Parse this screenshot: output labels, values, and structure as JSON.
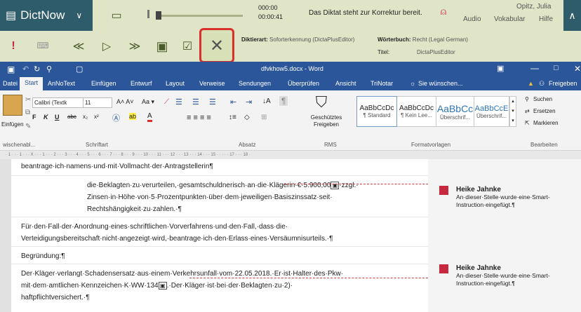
{
  "dictnow": {
    "app_name": "DictNow",
    "time_current": "000:00",
    "time_total": "00:00:41",
    "status": "Das Diktat steht zur Korrektur bereit.",
    "audio": "Audio",
    "vocabulary": "Vokabular",
    "help": "Hilfe",
    "user": "Opitz, Julia",
    "dictation_type_label": "Diktierart:",
    "dictation_type_value": "Soforterkennung (DictaPlusEditor)",
    "dictionary_label": "Wörterbuch:",
    "dictionary_value": "Recht (Legal German)",
    "title_label": "Titel:",
    "title_value": "DictaPlusEditor"
  },
  "word": {
    "title": "dfvkhow5.docx - Word",
    "tabs": [
      "Datei",
      "Start",
      "AnNoText",
      "Einfügen",
      "Entwurf",
      "Layout",
      "Verweise",
      "Sendungen",
      "Überprüfen",
      "Ansicht",
      "TriNotar"
    ],
    "tell_me": "Sie wünschen...",
    "share": "Freigeben",
    "ribbon": {
      "paste": "Einfügen",
      "font_name": "Calibri (Textk",
      "font_size": "11",
      "shared_label": "Geschütztes Freigeben",
      "styles": [
        {
          "sample": "AaBbCcDc",
          "name": "¶ Standard"
        },
        {
          "sample": "AaBbCcDc",
          "name": "¶ Kein Lee..."
        },
        {
          "sample": "AaBbCc",
          "name": "Überschrif..."
        },
        {
          "sample": "AaBbCcE",
          "name": "Überschrif..."
        }
      ],
      "search": "Suchen",
      "replace": "Ersetzen",
      "mark": "Markieren",
      "groups": [
        "wischenabl...",
        "Schriftart",
        "Absatz",
        "RMS",
        "Formatvorlagen",
        "Bearbeiten"
      ]
    },
    "ruler": "· 1 · · · 1 · · · X · · · 1 · · · 2 · · · 3 · · · 4 · · · 5 · · · 6 · · · 7 · · · 8 · · · 9 · · · 10 · · · 11 · · · 12 · · · 13 · · · 14 · · · 15 · · · · · 17 · · · 18 ·",
    "document": {
      "p1": "beantrage·ich·namens·und·mit·Vollmacht·der·Antragstellerin¶",
      "p2a": "die·Beklagten·zu·verurteilen,·gesamtschuldnerisch·an·die·Klägerin·€·5.900,00",
      "p2a_end": "·zzgl.·",
      "p2b": "Zinsen·in·Höhe·von·5·Prozentpunkten·über·dem·jeweiligen·Basiszinssatz·seit·",
      "p2c": "Rechtshängigkeit·zu·zahlen.·¶",
      "p3a": "Für·den·Fall·der·Anordnung·eines·schriftlichen·Vorverfahrens·und·den·Fall,·dass·die·",
      "p3b": "Verteidigungsbereitschaft·nicht·angezeigt·wird,·beantrage·ich·den·Erlass·eines·Versäumnisurteils.·¶",
      "p4": "Begründung:¶",
      "p5a": "Der·Kläger·verlangt·Schadensersatz·aus·einem·Verkehrsunfall·vom·22.05.2018.·Er·ist·Halter·des·Pkw·",
      "p5b_start": "mit·dem·amtlichen·Kennzeichen·K·WW·134",
      "p5b_end": ".·Der·Kläger·ist·bei·der·Beklagten·zu·2)·",
      "p5c": "haftpflichtversichert.·¶"
    },
    "comments": [
      {
        "author": "Heike Jahnke",
        "text": "An·dieser·Stelle·wurde·eine·Smart-Instruction·eingefügt.¶"
      },
      {
        "author": "Heike Jahnke",
        "text": "An·dieser·Stelle·wurde·eine·Smart-Instruction·eingefügt.¶"
      }
    ]
  }
}
